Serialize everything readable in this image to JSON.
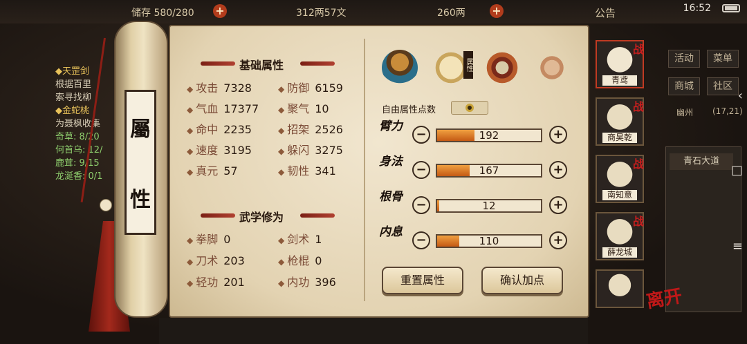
{
  "topbar": {
    "resource1": "储存 580/280",
    "resource2": "312两57文",
    "resource3": "260两",
    "notice": "公告",
    "time": "16:52"
  },
  "quest": {
    "lines": [
      {
        "text": "◆天罡剑",
        "style": "hd"
      },
      {
        "text": "根据百里",
        "style": ""
      },
      {
        "text": "索寻找柳",
        "style": ""
      },
      {
        "text": "◆金蛇桃",
        "style": "hd"
      },
      {
        "text": "为聂枫收集",
        "style": ""
      },
      {
        "text": "奇草: 8/20",
        "style": "gr"
      },
      {
        "text": "何首乌: 12/",
        "style": "gr"
      },
      {
        "text": "鹿茸: 9/15",
        "style": "gr"
      },
      {
        "text": "龙涎香: 0/1",
        "style": "gr"
      }
    ]
  },
  "right_menu": {
    "buttons": [
      "活动",
      "菜单",
      "商城",
      "社区"
    ],
    "location": "幽州",
    "coords": "(17,21)",
    "road": "青石大道"
  },
  "scroll": {
    "label_top": "屬",
    "label_bottom": "性"
  },
  "basic": {
    "title": "基础属性",
    "stats": [
      {
        "label": "攻击",
        "value": "7328"
      },
      {
        "label": "防御",
        "value": "6159"
      },
      {
        "label": "气血",
        "value": "17377"
      },
      {
        "label": "聚气",
        "value": "10"
      },
      {
        "label": "命中",
        "value": "2235"
      },
      {
        "label": "招架",
        "value": "2526"
      },
      {
        "label": "速度",
        "value": "3195"
      },
      {
        "label": "躲闪",
        "value": "3275"
      },
      {
        "label": "真元",
        "value": "57"
      },
      {
        "label": "韧性",
        "value": "341"
      }
    ]
  },
  "martial": {
    "title": "武学修为",
    "stats": [
      {
        "label": "拳脚",
        "value": "0"
      },
      {
        "label": "剑术",
        "value": "1"
      },
      {
        "label": "刀术",
        "value": "203"
      },
      {
        "label": "枪棍",
        "value": "0"
      },
      {
        "label": "轻功",
        "value": "201"
      },
      {
        "label": "内功",
        "value": "396"
      }
    ]
  },
  "tabs": {
    "icons": [
      "hat-icon",
      "attribute-book-icon",
      "taiji-icon",
      "body-meridian-icon"
    ],
    "book_tag": "属性"
  },
  "free_points": {
    "label": "自由属性点数",
    "value": "0"
  },
  "attributes": [
    {
      "name": "臂力",
      "value": "192",
      "fill": 0.36
    },
    {
      "name": "身法",
      "value": "167",
      "fill": 0.31
    },
    {
      "name": "根骨",
      "value": "12",
      "fill": 0.02
    },
    {
      "name": "内息",
      "value": "110",
      "fill": 0.21
    }
  ],
  "buttons": {
    "reset": "重置属性",
    "confirm": "确认加点"
  },
  "party": [
    {
      "name": "青鸢",
      "badge": "战"
    },
    {
      "name": "商昊乾",
      "badge": "战"
    },
    {
      "name": "南知意",
      "badge": "战"
    },
    {
      "name": "薛龙城",
      "badge": "战"
    }
  ],
  "leave_label": "离开",
  "colors": {
    "accent": "#c03a22",
    "paper": "#e3d3b2",
    "bar_fill": "#e08a2c"
  }
}
